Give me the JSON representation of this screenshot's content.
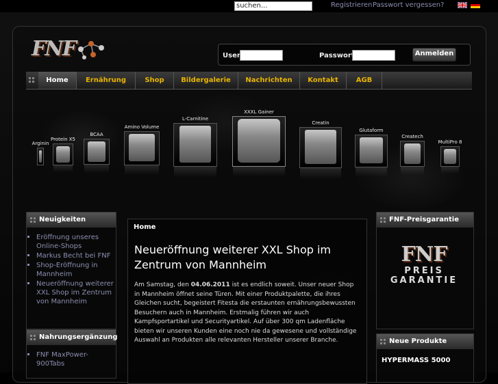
{
  "top": {
    "search_value": "suchen...",
    "register": "Registrieren",
    "forgot": "Passwort vergessen?"
  },
  "login": {
    "user_label": "User",
    "password_label": "Passwort",
    "button": "Anmelden"
  },
  "logo": "FNF",
  "nav": [
    "Home",
    "Ernährung",
    "Shop",
    "Bildergalerie",
    "Nachrichten",
    "Kontakt",
    "AGB"
  ],
  "products": [
    "Arginin",
    "Protein X5",
    "BCAA",
    "Amino Volume",
    "L-Carnitine",
    "XXXL Gainer",
    "Creatin",
    "Glutaform",
    "Createch",
    "MultiPro 8"
  ],
  "left": {
    "news_title": "Neuigkeiten",
    "news": [
      "Eröffnung unseres Online-Shops",
      "Markus Becht bei FNF",
      "Shop-Eröffnung in Mannheim",
      "Neueröffnung weiterer XXL Shop im Zentrum von Mannheim"
    ],
    "supp_title": "Nahrungsergänzung",
    "supp": [
      "FNF MaxPower-900Tabs"
    ]
  },
  "main": {
    "breadcrumb": "Home",
    "title": "Neueröffnung weiterer XXL Shop im Zentrum von Mannheim",
    "body_pre": "Am Samstag, den ",
    "body_date": "04.06.2011",
    "body_post": " ist es endlich soweit. Unser neuer Shop in Mannheim öffnet seine Türen. Mit einer Produktpalette, die ihres Gleichen sucht, begeistert Fitesta die erstaunten ernährungsbewussten Besuchern auch in Mannheim. Erstmalig führen wir auch Kampfsportartikel und Securityartikel. Auf über 300 qm Ladenfläche bieten wir unseren Kunden eine noch nie da gewesene und vollständige Auswahl an Produkten alle relevanten Hersteller unserer Branche."
  },
  "right": {
    "price_title": "FNF-Preisgarantie",
    "promo_logo": "FNF",
    "promo_line1": "PREIS",
    "promo_line2": "GARANTIE",
    "new_title": "Neue Produkte",
    "new_item": "HYPERMASS 5000"
  },
  "colors": {
    "nav_text": "#e8b400",
    "link": "#8b8fb0"
  }
}
